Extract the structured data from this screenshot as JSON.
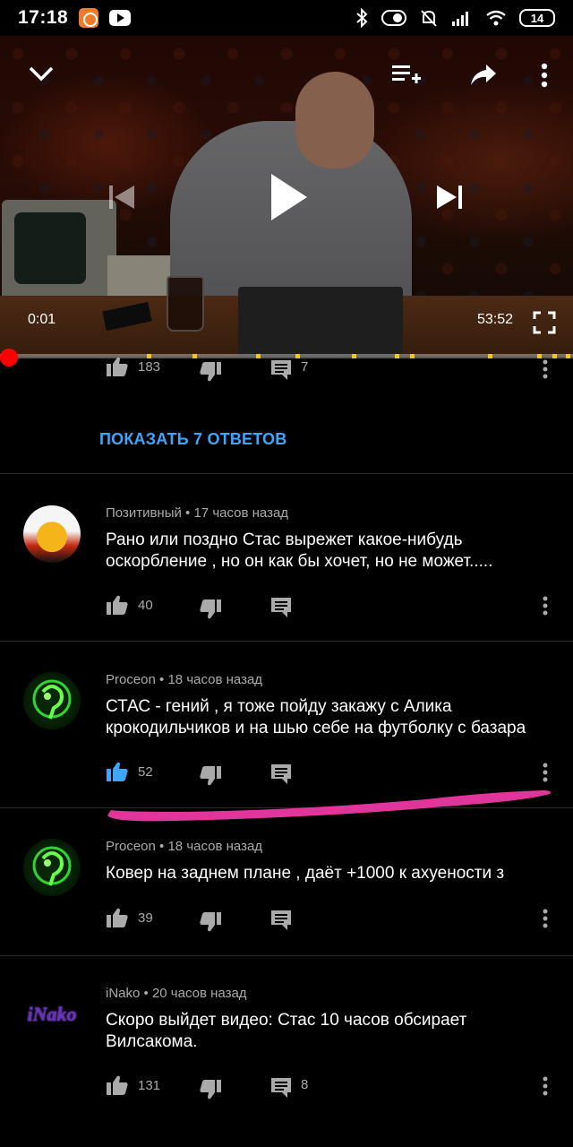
{
  "status_bar": {
    "time": "17:18",
    "battery": "14"
  },
  "player": {
    "current_time": "0:01",
    "total_time": "53:52",
    "progress": 0.0003,
    "marker_count": 11
  },
  "top_comment_actions": {
    "likes": "183",
    "replies": "7"
  },
  "show_replies_label": "ПОКАЗАТЬ 7 ОТВЕТОВ",
  "comments": [
    {
      "author": "Позитивный",
      "time": "17 часов назад",
      "text": "Рано или поздно Стас вырежет какое-нибудь оскорбление , но он как бы хочет, но не может.....",
      "likes": "40",
      "replies": "",
      "liked": false
    },
    {
      "author": "Proceon",
      "time": "18 часов назад",
      "text": "СТАС - гений , я тоже пойду закажу с Алика крокодильчиков и на шью себе на футболку с базара",
      "likes": "52",
      "replies": "",
      "liked": true
    },
    {
      "author": "Proceon",
      "time": "18 часов назад",
      "text": "Ковер на заднем плане , даёт +1000 к ахуености з",
      "likes": "39",
      "replies": "",
      "liked": false
    },
    {
      "author": "iNako",
      "time": "20 часов назад",
      "text": "Скоро выйдет видео: Стас 10 часов обсирает Вилсакома.",
      "likes": "131",
      "replies": "8",
      "liked": false,
      "avatar_text": "iNako"
    }
  ],
  "colors": {
    "accent_blue": "#3ea6ff",
    "progress_red": "#ff0000",
    "highlight_pink": "#e0359a"
  }
}
